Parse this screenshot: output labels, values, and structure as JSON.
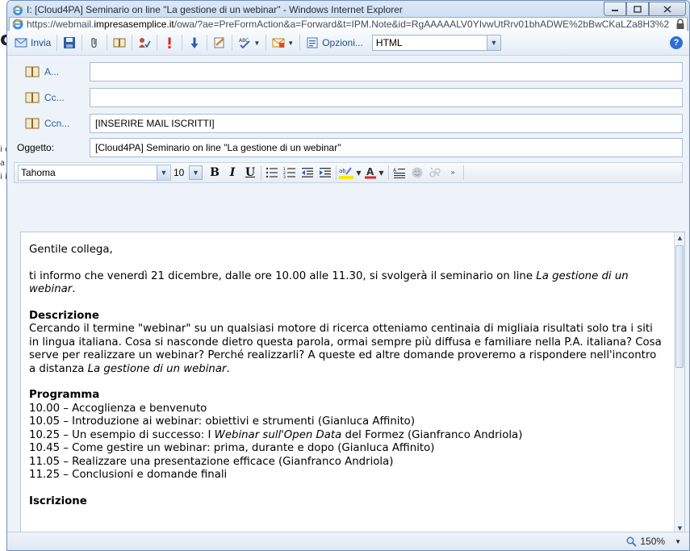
{
  "background_page": {
    "heading_fragment": "ci",
    "fragments": [
      "i c",
      "a",
      "i i"
    ]
  },
  "window": {
    "title": "I: [Cloud4PA] Seminario on line \"La gestione di un webinar\" - Windows Internet Explorer",
    "url_prefix": "https://webmail.",
    "url_domain": "impresasemplice.it",
    "url_rest": "/owa/?ae=PreFormAction&a=Forward&t=IPM.Note&id=RgAAAAALV0YIvwUtRrv01bhADWE%2bBwCKaLZa8H3%2"
  },
  "toolbar": {
    "send_label": "Invia",
    "options_label": "Opzioni...",
    "format_value": "HTML"
  },
  "fields": {
    "to_label": "A...",
    "to_value": "",
    "cc_label": "Cc...",
    "cc_value": "",
    "bcc_label": "Ccn...",
    "bcc_value": "[INSERIRE MAIL ISCRITTI]",
    "subject_label": "Oggetto:",
    "subject_value": "[Cloud4PA] Seminario on line \"La gestione di un webinar\""
  },
  "format_bar": {
    "font": "Tahoma",
    "size": "10"
  },
  "message": {
    "greeting": "Gentile collega,",
    "intro_text": "ti informo che venerdì 21 dicembre, dalle ore 10.00 alle 11.30, si svolgerà il seminario on line ",
    "intro_title": "La gestione di un webinar",
    "intro_end": ".",
    "desc_heading": "Descrizione",
    "desc_text": "Cercando il termine \"webinar\" su un qualsiasi motore di ricerca otteniamo centinaia di migliaia risultati solo tra i siti in lingua italiana. Cosa si nasconde dietro questa parola, ormai sempre più diffusa e familiare nella P.A. italiana? Cosa serve per realizzare un webinar? Perché realizzarli? A queste ed altre domande proveremo a rispondere nell'incontro a distanza ",
    "desc_title": "La gestione di un webinar",
    "desc_end": ".",
    "prog_heading": "Programma",
    "prog_1": "10.00 – Accoglienza e benvenuto",
    "prog_2": "10.05 – Introduzione ai webinar: obiettivi e strumenti (Gianluca Affinito)",
    "prog_3a": "10.25 – Un esempio di successo: I ",
    "prog_3b": "Webinar sull'Open Data",
    "prog_3c": " del Formez (Gianfranco Andriola)",
    "prog_4": "10.45 – Come gestire un webinar: prima, durante e dopo (Gianluca Affinito)",
    "prog_5": "11.05 – Realizzare una presentazione efficace (Gianfranco Andriola)",
    "prog_6": "11.25 – Conclusioni e domande finali",
    "next_heading": "Iscrizione"
  },
  "status": {
    "zoom": "150%"
  },
  "colors": {
    "link_blue": "#2b5ea8",
    "title_bar": "#c3d6ee",
    "window_bg": "#eef3f9"
  }
}
